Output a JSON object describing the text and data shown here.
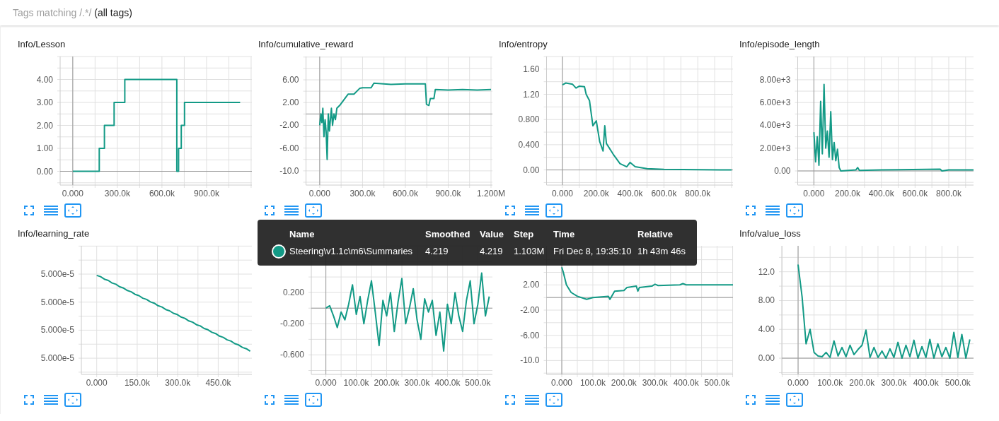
{
  "filter_bar": {
    "label": "Tags matching /.*/",
    "value": "(all tags)"
  },
  "charts": [
    {
      "title": "Info/Lesson",
      "chart_data": {
        "type": "line",
        "x": [
          0,
          178000,
          178000,
          213000,
          213000,
          278000,
          278000,
          350000,
          350000,
          700000,
          700000,
          712000,
          712000,
          730000,
          730000,
          752000,
          752000,
          1126000
        ],
        "series": [
          {
            "color": "#139a86",
            "values": [
              0,
              0,
              1,
              1,
              2,
              2,
              3,
              3,
              4,
              4,
              0,
              0,
              1,
              1,
              2,
              2,
              3,
              3
            ]
          }
        ],
        "xlim": [
          -85000,
          1205000
        ],
        "ylim": [
          -0.6,
          5.0
        ],
        "xticks": [
          {
            "value": 0,
            "label": "0.000"
          },
          {
            "value": 300000,
            "label": "300.0k"
          },
          {
            "value": 600000,
            "label": "600.0k"
          },
          {
            "value": 900000,
            "label": "900.0k"
          }
        ],
        "yticks": [
          {
            "value": 0,
            "label": "0.00"
          },
          {
            "value": 1,
            "label": "1.00"
          },
          {
            "value": 2,
            "label": "2.00"
          },
          {
            "value": 3,
            "label": "3.00"
          },
          {
            "value": 4,
            "label": "4.00"
          }
        ],
        "grid": true
      }
    },
    {
      "title": "Info/cumulative_reward",
      "chart_data": {
        "type": "line",
        "x": [
          0,
          8000,
          15000,
          22000,
          30000,
          38000,
          45000,
          52000,
          60000,
          68000,
          75000,
          82000,
          90000,
          100000,
          110000,
          120000,
          140000,
          170000,
          200000,
          240000,
          280000,
          300000,
          360000,
          380000,
          500000,
          600000,
          740000,
          748000,
          765000,
          775000,
          800000,
          810000,
          900000,
          1000000,
          1103000,
          1200000
        ],
        "series": [
          {
            "color": "#139a86",
            "values": [
              -2,
              0,
              -1.5,
              1,
              -4,
              -1,
              -3,
              -8,
              0,
              -3,
              -1,
              1,
              -2,
              0,
              -1,
              1,
              1.5,
              2.5,
              3.5,
              3.5,
              4.5,
              4.6,
              4.6,
              5.4,
              5.2,
              5.3,
              5.3,
              1.7,
              1.5,
              2.7,
              2.7,
              4.3,
              4.2,
              4.3,
              4.2,
              4.3
            ]
          }
        ],
        "xlim": [
          -96000,
          1210000
        ],
        "ylim": [
          -12.5,
          10.1
        ],
        "xticks": [
          {
            "value": 0,
            "label": "0.000"
          },
          {
            "value": 300000,
            "label": "300.0k"
          },
          {
            "value": 600000,
            "label": "600.0k"
          },
          {
            "value": 900000,
            "label": "900.0k"
          },
          {
            "value": 1200000,
            "label": "1.200M"
          }
        ],
        "yticks": [
          {
            "value": -10,
            "label": "-10.0"
          },
          {
            "value": -6,
            "label": "-6.00"
          },
          {
            "value": -2,
            "label": "-2.00"
          },
          {
            "value": 2,
            "label": "2.00"
          },
          {
            "value": 6,
            "label": "6.00"
          }
        ],
        "grid": true
      }
    },
    {
      "title": "Info/entropy",
      "chart_data": {
        "type": "line",
        "x": [
          0,
          20000,
          60000,
          80000,
          100000,
          130000,
          140000,
          160000,
          180000,
          200000,
          220000,
          240000,
          250000,
          260000,
          300000,
          340000,
          380000,
          400000,
          430000,
          500000,
          600000,
          1000000
        ],
        "series": [
          {
            "color": "#139a86",
            "values": [
              1.35,
              1.38,
              1.36,
              1.3,
              1.33,
              1.32,
              1.2,
              1.1,
              0.7,
              0.78,
              0.45,
              0.3,
              0.7,
              0.42,
              0.25,
              0.1,
              0.05,
              0.12,
              0.05,
              0.02,
              0.01,
              0.0
            ]
          }
        ],
        "xlim": [
          -94000,
          1008000
        ],
        "ylim": [
          -0.24,
          1.8
        ],
        "xticks": [
          {
            "value": 0,
            "label": "0.000"
          },
          {
            "value": 200000,
            "label": "200.0k"
          },
          {
            "value": 400000,
            "label": "400.0k"
          },
          {
            "value": 600000,
            "label": "600.0k"
          },
          {
            "value": 800000,
            "label": "800.0k"
          }
        ],
        "yticks": [
          {
            "value": 0,
            "label": "0.00"
          },
          {
            "value": 0.4,
            "label": "0.400"
          },
          {
            "value": 0.8,
            "label": "0.800"
          },
          {
            "value": 1.2,
            "label": "1.20"
          },
          {
            "value": 1.6,
            "label": "1.60"
          }
        ],
        "grid": true
      }
    },
    {
      "title": "Info/episode_length",
      "chart_data": {
        "type": "line",
        "x": [
          0,
          10000,
          20000,
          30000,
          40000,
          50000,
          60000,
          70000,
          80000,
          90000,
          100000,
          110000,
          120000,
          130000,
          140000,
          150000,
          160000,
          250000,
          260000,
          270000,
          400000,
          750000,
          760000,
          800000,
          947000
        ],
        "series": [
          {
            "color": "#139a86",
            "values": [
              3400,
              800,
              3000,
              500,
              6100,
              1500,
              7600,
              2000,
              3500,
              1200,
              5200,
              1000,
              2500,
              900,
              1900,
              300,
              0,
              100,
              300,
              50,
              100,
              150,
              0,
              100,
              100
            ]
          }
        ],
        "xlim": [
          -96000,
          947000
        ],
        "ylim": [
          -1240,
          10040
        ],
        "xticks": [
          {
            "value": 0,
            "label": "0.000"
          },
          {
            "value": 200000,
            "label": "200.0k"
          },
          {
            "value": 400000,
            "label": "400.0k"
          },
          {
            "value": 600000,
            "label": "600.0k"
          },
          {
            "value": 800000,
            "label": "800.0k"
          }
        ],
        "yticks": [
          {
            "value": 0,
            "label": "0.00"
          },
          {
            "value": 2000,
            "label": "2.00e+3"
          },
          {
            "value": 4000,
            "label": "4.00e+3"
          },
          {
            "value": 6000,
            "label": "6.00e+3"
          },
          {
            "value": 8000,
            "label": "8.00e+3"
          }
        ],
        "grid": true
      }
    },
    {
      "title": "Info/learning_rate",
      "kind": "plot_picture",
      "y_labels": [
        "5.000e-5",
        "5.000e-5",
        "5.000e-5",
        "5.000e-5"
      ],
      "x_labels": [
        "0.000",
        "150.0k",
        "300.0k",
        "450.0k"
      ]
    },
    {
      "chart_data": {
        "type": "line",
        "x": [
          0,
          12500,
          25000,
          37500,
          50000,
          62500,
          75000,
          87500,
          100000,
          112500,
          125000,
          137500,
          150000,
          162500,
          175000,
          187500,
          200000,
          212500,
          225000,
          237500,
          250000,
          262500,
          275000,
          287500,
          300000,
          312500,
          325000,
          337500,
          350000,
          362500,
          375000,
          387500,
          400000,
          412500,
          425000,
          437500,
          450000,
          462500,
          475000,
          487500,
          500000,
          512500,
          525000,
          537500
        ],
        "series": [
          {
            "color": "#139a86",
            "values": [
              0.0,
              0.03,
              -0.1,
              -0.25,
              -0.05,
              -0.15,
              0.05,
              0.3,
              -0.08,
              0.15,
              -0.2,
              0.1,
              0.35,
              -0.05,
              -0.48,
              0.1,
              -0.1,
              0.2,
              -0.3,
              0.08,
              0.38,
              -0.2,
              0.0,
              0.25,
              -0.15,
              -0.4,
              0.12,
              -0.05,
              0.1,
              -0.35,
              -0.05,
              -0.55,
              0.05,
              -0.2,
              0.2,
              -0.1,
              -0.3,
              0.1,
              0.35,
              -0.2,
              0.05,
              0.45,
              -0.1,
              0.15
            ]
          }
        ],
        "xlim": [
          -48000,
          548000
        ],
        "ylim": [
          -0.85,
          0.8
        ],
        "xticks": [
          {
            "value": 0,
            "label": "0.000"
          },
          {
            "value": 100000,
            "label": "100.0k"
          },
          {
            "value": 200000,
            "label": "200.0k"
          },
          {
            "value": 300000,
            "label": "300.0k"
          },
          {
            "value": 400000,
            "label": "400.0k"
          },
          {
            "value": 500000,
            "label": "500.0k"
          }
        ],
        "yticks": [
          {
            "value": -0.6,
            "label": "-0.600"
          },
          {
            "value": -0.2,
            "label": "-0.200"
          },
          {
            "value": 0.2,
            "label": "0.200"
          }
        ],
        "grid": true
      }
    },
    {
      "chart_data": {
        "type": "line",
        "x": [
          0,
          5000,
          15000,
          30000,
          50000,
          80000,
          100000,
          150000,
          155000,
          170000,
          200000,
          210000,
          240000,
          245000,
          250000,
          290000,
          300000,
          310000,
          380000,
          390000,
          400000,
          551000
        ],
        "series": [
          {
            "color": "#139a86",
            "values": [
              4.8,
              4,
              2,
              0.8,
              0.2,
              -0.3,
              0,
              0.2,
              -0.3,
              1,
              1.1,
              1.6,
              1.8,
              1,
              1.6,
              1.8,
              2.1,
              1.9,
              2,
              2.2,
              2,
              2
            ]
          }
        ],
        "xlim": [
          -49000,
          551000
        ],
        "ylim": [
          -12.2,
          8.2
        ],
        "xticks": [
          {
            "value": 0,
            "label": "0.000"
          },
          {
            "value": 100000,
            "label": "100.0k"
          },
          {
            "value": 200000,
            "label": "200.0k"
          },
          {
            "value": 300000,
            "label": "300.0k"
          },
          {
            "value": 400000,
            "label": "400.0k"
          },
          {
            "value": 500000,
            "label": "500.0k"
          }
        ],
        "yticks": [
          {
            "value": -10,
            "label": "-10.0"
          },
          {
            "value": -6,
            "label": "-6.00"
          },
          {
            "value": -2,
            "label": "-2.00"
          },
          {
            "value": 2,
            "label": "2.00"
          }
        ],
        "grid": true
      }
    },
    {
      "title": "Info/value_loss",
      "chart_data": {
        "type": "line",
        "x": [
          0,
          12500,
          25000,
          37500,
          50000,
          62500,
          75000,
          87500,
          100000,
          112500,
          125000,
          137500,
          150000,
          162500,
          175000,
          187500,
          200000,
          212500,
          225000,
          237500,
          250000,
          262500,
          275000,
          287500,
          300000,
          312500,
          325000,
          337500,
          350000,
          362500,
          375000,
          387500,
          400000,
          412500,
          425000,
          437500,
          450000,
          462500,
          475000,
          487500,
          500000,
          512500,
          525000,
          537500
        ],
        "series": [
          {
            "color": "#139a86",
            "values": [
              13,
              8.5,
              2,
              4,
              0.8,
              0.3,
              0.2,
              0.8,
              0.1,
              2.4,
              0.3,
              1.5,
              0.2,
              1.8,
              0.5,
              1.2,
              1.8,
              3.9,
              0.1,
              1.5,
              0.1,
              1.0,
              0.0,
              1.3,
              0.1,
              2.2,
              0.0,
              1.8,
              0.2,
              2.5,
              0.0,
              1.6,
              0.1,
              2.6,
              0.0,
              2.0,
              0.2,
              1.5,
              0.0,
              3.6,
              0.1,
              3.3,
              0.0,
              2.6
            ]
          }
        ],
        "xlim": [
          -51000,
          549000
        ],
        "ylim": [
          -2.25,
          15.6
        ],
        "xticks": [
          {
            "value": 0,
            "label": "0.000"
          },
          {
            "value": 100000,
            "label": "100.0k"
          },
          {
            "value": 200000,
            "label": "200.0k"
          },
          {
            "value": 300000,
            "label": "300.0k"
          },
          {
            "value": 400000,
            "label": "400.0k"
          },
          {
            "value": 500000,
            "label": "500.0k"
          }
        ],
        "yticks": [
          {
            "value": 0,
            "label": "0.00"
          },
          {
            "value": 4,
            "label": "4.00"
          },
          {
            "value": 8,
            "label": "8.00"
          },
          {
            "value": 12,
            "label": "12.0"
          }
        ],
        "grid": true
      }
    }
  ],
  "tooltip": {
    "columns": [
      "Name",
      "Smoothed",
      "Value",
      "Step",
      "Time",
      "Relative"
    ],
    "rows": [
      {
        "color": "#139a86",
        "name": "Steering\\v1.1c\\m6\\Summaries",
        "smoothed": "4.219",
        "value": "4.219",
        "step": "1.103M",
        "time": "Fri Dec 8, 19:35:10",
        "relative": "1h 43m 46s"
      }
    ]
  }
}
